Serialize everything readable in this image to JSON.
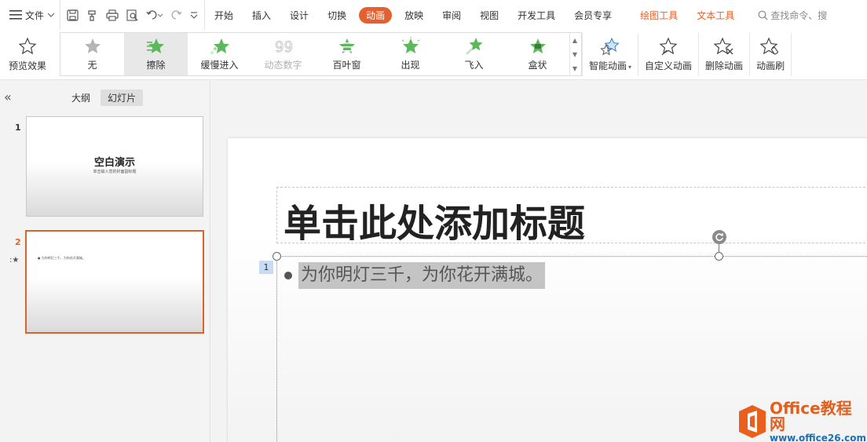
{
  "menubar": {
    "file_label": "文件",
    "tabs": [
      "开始",
      "插入",
      "设计",
      "切换",
      "动画",
      "放映",
      "审阅",
      "视图",
      "开发工具",
      "会员专享"
    ],
    "active_tab": "动画",
    "context_tabs": [
      "绘图工具",
      "文本工具"
    ],
    "search_placeholder": "查找命令、搜"
  },
  "ribbon": {
    "preview_label": "预览效果",
    "gallery": [
      {
        "label": "无",
        "icon": "star-none-icon"
      },
      {
        "label": "擦除",
        "icon": "star-wipe-icon",
        "selected": true
      },
      {
        "label": "缓慢进入",
        "icon": "star-slow-enter-icon"
      },
      {
        "label": "动态数字",
        "icon": "dynamic-number-icon",
        "disabled": true
      },
      {
        "label": "百叶窗",
        "icon": "star-blinds-icon"
      },
      {
        "label": "出现",
        "icon": "star-appear-icon"
      },
      {
        "label": "飞入",
        "icon": "star-fly-in-icon"
      },
      {
        "label": "盒状",
        "icon": "star-box-icon"
      }
    ],
    "smart_animation_label": "智能动画",
    "custom_animation_label": "自定义动画",
    "delete_animation_label": "删除动画",
    "animation_brush_label": "动画刷"
  },
  "left_panel": {
    "view_tabs": [
      "大纲",
      "幻灯片"
    ],
    "active_view": "幻灯片",
    "slides": [
      {
        "number": "1",
        "title": "空白演示",
        "subtitle": "单击输入您的封面副标题"
      },
      {
        "number": "2",
        "bullet": "● 为你明灯三千，为你花开满城。"
      }
    ],
    "selected_slide": "2"
  },
  "slide": {
    "title": "单击此处添加标题",
    "animation_order": "1",
    "bullet_text": "为你明灯三千，为你花开满城。"
  },
  "watermark": {
    "line1_en": "Office",
    "line1_cn": "教程网",
    "line2": "www.office26.com"
  },
  "colors": {
    "accent": "#e4602e",
    "star_green": "#5cb85c",
    "selection_highlight": "#c4c4c4"
  }
}
